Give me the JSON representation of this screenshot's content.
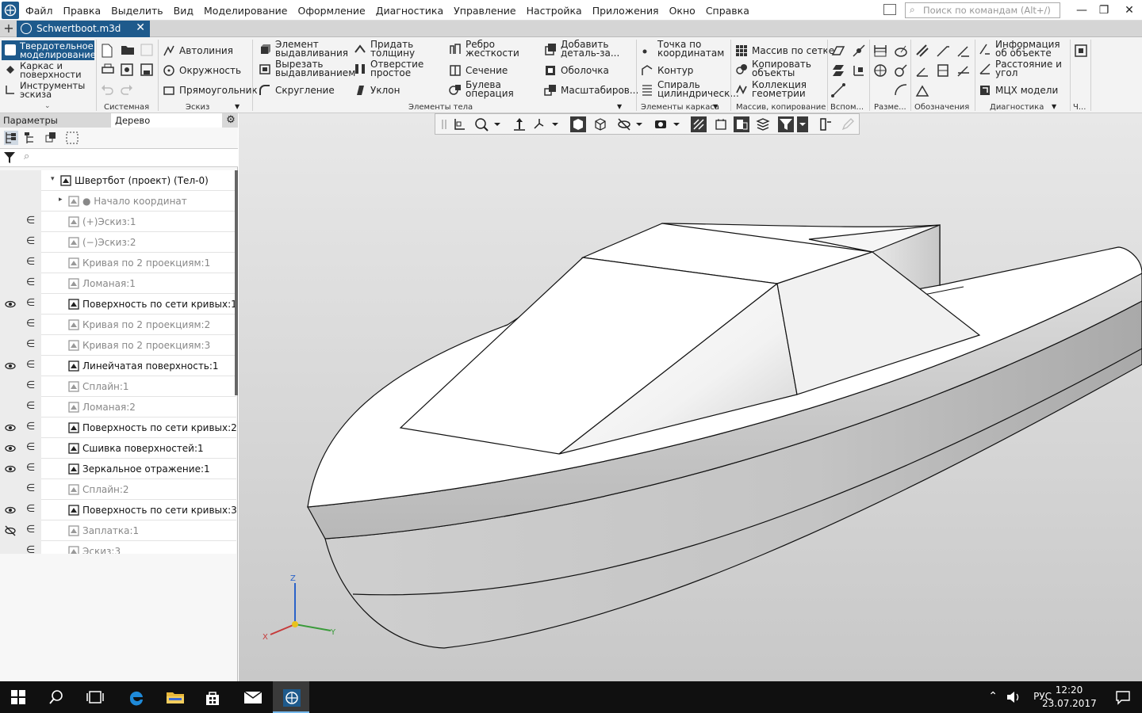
{
  "menu": [
    "Файл",
    "Правка",
    "Выделить",
    "Вид",
    "Моделирование",
    "Оформление",
    "Диагностика",
    "Управление",
    "Настройка",
    "Приложения",
    "Окно",
    "Справка"
  ],
  "search": {
    "placeholder": "Поиск по командам (Alt+/)"
  },
  "window_buttons": {
    "minimize": "—",
    "maximize": "❐",
    "close": "✕"
  },
  "document_tab": {
    "name": "Schwertboot.m3d",
    "plus": "+",
    "close": "✕"
  },
  "modes": [
    {
      "label": "Твердотельное моделирование",
      "icon": "solid-icon"
    },
    {
      "label": "Каркас и поверхности",
      "icon": "surface-icon"
    },
    {
      "label": "Инструменты эскиза",
      "icon": "sketch-tools-icon"
    }
  ],
  "ribbon": {
    "sketch": [
      "Автолиния",
      "Окружность",
      "Прямоугольник"
    ],
    "body": [
      "Элемент выдавливания",
      "Вырезать выдавливанием",
      "Скругление",
      "Придать толщину",
      "Отверстие простое",
      "Уклон",
      "Ребро жесткости",
      "Сечение",
      "Булева операция",
      "Добавить деталь-за...",
      "Оболочка",
      "Масштабиров..."
    ],
    "frame": [
      "Точка по координатам",
      "Контур",
      "Спираль цилиндрическ..."
    ],
    "array": [
      "Массив по сетке",
      "Копировать объекты",
      "Коллекция геометрии"
    ],
    "diag": [
      "Информация об объекте",
      "Расстояние и угол",
      "МЦХ модели"
    ]
  },
  "groups": [
    "Системная",
    "Эскиз",
    "Элементы тела",
    "Элементы каркаса",
    "Массив, копирование",
    "Вспом...",
    "Разме...",
    "Обозначения",
    "Диагностика",
    "Ч..."
  ],
  "panel": {
    "tab_params": "Параметры",
    "tab_tree": "Дерево",
    "filter_placeholder": "⌕"
  },
  "tree": [
    {
      "label": "Швертбот (проект) (Тел-0)",
      "level": 0,
      "visible": null,
      "style": "bold",
      "expander": "▾",
      "relation": false
    },
    {
      "label": "● Начало координат",
      "level": 1,
      "visible": null,
      "style": "dim",
      "expander": "▸",
      "relation": false
    },
    {
      "label": "(+)Эскиз:1",
      "level": 1,
      "visible": false,
      "style": "dim",
      "relation": true
    },
    {
      "label": "(−)Эскиз:2",
      "level": 1,
      "visible": false,
      "style": "dim",
      "relation": true
    },
    {
      "label": "Кривая по 2 проекциям:1",
      "level": 1,
      "visible": false,
      "style": "dim",
      "relation": true
    },
    {
      "label": "Ломаная:1",
      "level": 1,
      "visible": false,
      "style": "dim",
      "relation": true
    },
    {
      "label": "Поверхность по сети кривых:1",
      "level": 1,
      "visible": true,
      "style": "bold",
      "relation": true
    },
    {
      "label": "Кривая по 2 проекциям:2",
      "level": 1,
      "visible": false,
      "style": "dim",
      "relation": true
    },
    {
      "label": "Кривая по 2 проекциям:3",
      "level": 1,
      "visible": false,
      "style": "dim",
      "relation": true
    },
    {
      "label": "Линейчатая поверхность:1",
      "level": 1,
      "visible": true,
      "style": "bold",
      "relation": true
    },
    {
      "label": "Сплайн:1",
      "level": 1,
      "visible": false,
      "style": "dim",
      "relation": true
    },
    {
      "label": "Ломаная:2",
      "level": 1,
      "visible": false,
      "style": "dim",
      "relation": true
    },
    {
      "label": "Поверхность по сети кривых:2",
      "level": 1,
      "visible": true,
      "style": "bold",
      "relation": true
    },
    {
      "label": "Сшивка поверхностей:1",
      "level": 1,
      "visible": true,
      "style": "bold",
      "relation": true
    },
    {
      "label": "Зеркальное отражение:1",
      "level": 1,
      "visible": true,
      "style": "bold",
      "relation": true
    },
    {
      "label": "Сплайн:2",
      "level": 1,
      "visible": false,
      "style": "dim",
      "relation": true
    },
    {
      "label": "Поверхность по сети кривых:3",
      "level": 1,
      "visible": true,
      "style": "bold",
      "relation": true
    },
    {
      "label": "Заплатка:1",
      "level": 1,
      "visible": "hidden",
      "style": "dim",
      "relation": true
    },
    {
      "label": "Эскиз:3",
      "level": 1,
      "visible": false,
      "style": "dim",
      "relation": true
    }
  ],
  "axes": {
    "x": "X",
    "y": "Y",
    "z": "Z"
  },
  "tray": {
    "lang": "РУС",
    "time": "12:20",
    "date": "23.07.2017",
    "up": "⌃"
  },
  "colors": {
    "accent": "#1e5a8c",
    "taskbar": "#101010",
    "viewport_top": "#e8e8e8",
    "viewport_bottom": "#c8c8c8"
  }
}
